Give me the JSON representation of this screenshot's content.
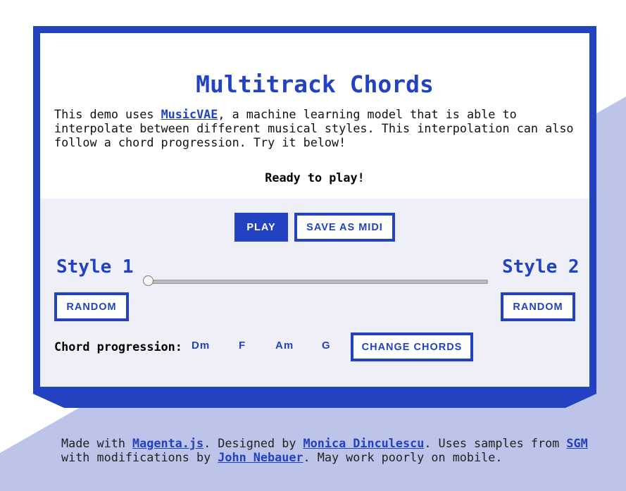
{
  "colors": {
    "accent": "#2242c2",
    "panel": "#eff0f7",
    "background_shape": "#bcc4e9"
  },
  "header": {
    "title": "Multitrack Chords"
  },
  "intro": {
    "prefix": "This demo uses ",
    "link": "MusicVAE",
    "suffix": ", a machine learning model that is able to interpolate between different musical styles. This interpolation can also follow a chord progression. Try it below!"
  },
  "status": "Ready to play!",
  "controls": {
    "play_label": "PLAY",
    "save_label": "SAVE AS MIDI",
    "style1_label": "Style 1",
    "style2_label": "Style 2",
    "random1_label": "RANDOM",
    "random2_label": "RANDOM",
    "slider_value": 0
  },
  "chords": {
    "label": "Chord progression:",
    "items": [
      "Dm",
      "F",
      "Am",
      "G"
    ],
    "change_label": "CHANGE CHORDS"
  },
  "footer": {
    "t1": "Made with ",
    "link1": "Magenta.js",
    "t2": ". Designed by ",
    "link2": "Monica Dinculescu",
    "t3": ". Uses samples from ",
    "link3": "SGM",
    "t4": " with modifications by ",
    "link4": "John Nebauer",
    "t5": ". May work poorly on mobile."
  }
}
